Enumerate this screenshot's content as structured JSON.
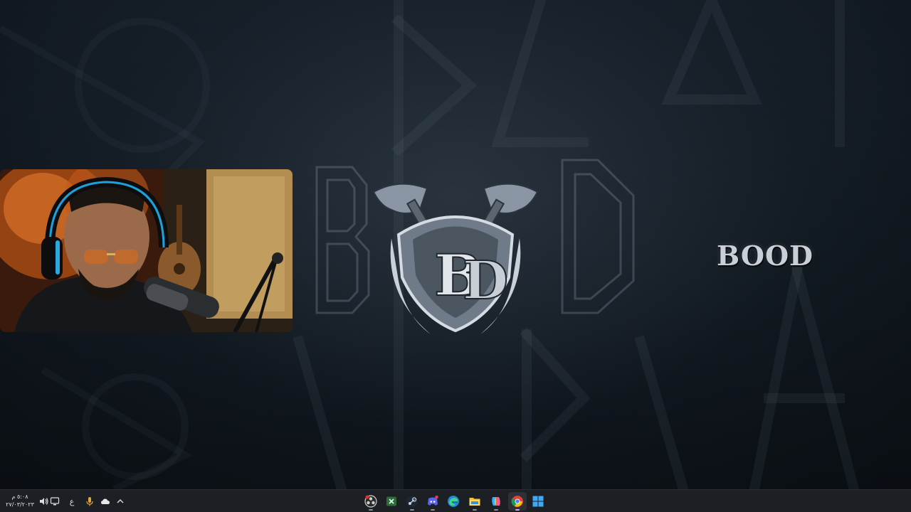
{
  "wallpaper": {
    "logo_text": "BOOD",
    "accent_color": "#c9cfd6"
  },
  "webcam": {
    "icon": "webcam-feed"
  },
  "taskbar": {
    "clock": {
      "time": "٥:٠٨ م",
      "date": "٢٧/٠٣/٢٠٢٣"
    },
    "tray": {
      "language": "ع",
      "icons": [
        "volume-icon",
        "display-icon",
        "language-indicator",
        "microphone-icon",
        "cloud-icon",
        "chevron-up-icon"
      ]
    },
    "apps": [
      {
        "name": "obs",
        "icon": "obs-icon"
      },
      {
        "name": "xbox",
        "icon": "xbox-icon"
      },
      {
        "name": "steam",
        "icon": "steam-icon"
      },
      {
        "name": "discord",
        "icon": "discord-icon"
      },
      {
        "name": "edge",
        "icon": "edge-icon"
      },
      {
        "name": "file-explorer",
        "icon": "folder-icon"
      },
      {
        "name": "copilot",
        "icon": "copilot-icon"
      },
      {
        "name": "chrome",
        "icon": "chrome-icon"
      },
      {
        "name": "start",
        "icon": "windows-start-icon"
      }
    ]
  }
}
